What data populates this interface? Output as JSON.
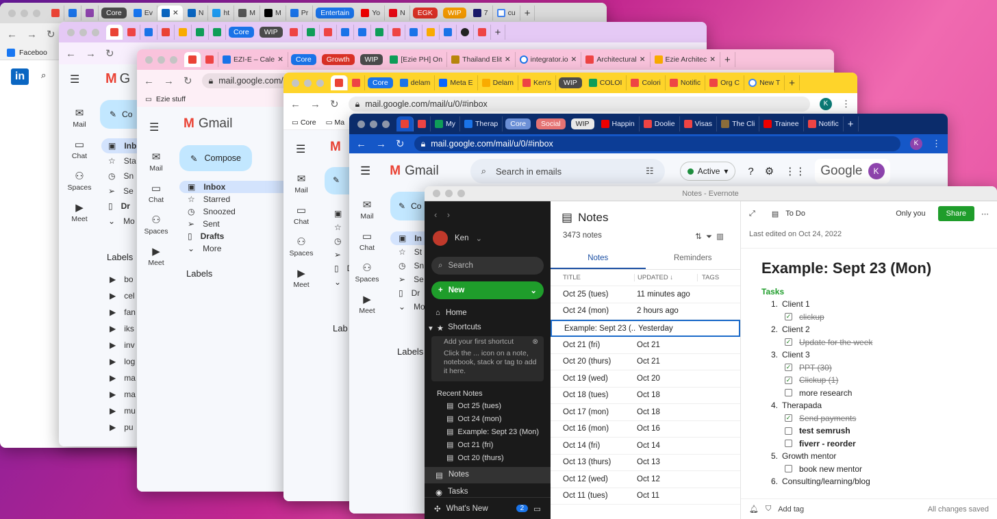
{
  "window1": {
    "tabs": [
      "Ev",
      "ht",
      "M",
      "Pr",
      "Yo",
      "N",
      "7",
      "cu"
    ],
    "groups": [
      {
        "label": "Core",
        "color": "#4a4a4a"
      },
      {
        "label": "Entertain",
        "color": "#1a73e8"
      },
      {
        "label": "EGK",
        "color": "#d93025"
      },
      {
        "label": "WIP",
        "color": "#f29900"
      }
    ],
    "bookmark": "Faceboo",
    "rail": [
      "Mail",
      "Chat",
      "Spaces",
      "Meet"
    ]
  },
  "window2": {
    "groups": [
      {
        "label": "Core",
        "color": "#1a73e8"
      },
      {
        "label": "WIP",
        "color": "#4a4a4a"
      }
    ],
    "gmail_g": "G",
    "compose": "Co",
    "rail": [
      "Mail",
      "Chat",
      "Spaces",
      "Meet"
    ],
    "nav": [
      "Inb",
      "Sta",
      "Sn",
      "Se",
      "Dr",
      "Mo"
    ],
    "labels_title": "Labels",
    "labels": [
      "bo",
      "cel",
      "fan",
      "iks",
      "inv",
      "log",
      "ma",
      "ma",
      "mu",
      "pu"
    ]
  },
  "window3": {
    "tabs": [
      "EZI-E – Cale",
      "[Ezie PH] On",
      "Thailand Elit",
      "integrator.io",
      "Architectural",
      "Ezie Architec"
    ],
    "groups": [
      {
        "label": "Core",
        "color": "#1a73e8"
      },
      {
        "label": "Growth",
        "color": "#d93025"
      },
      {
        "label": "WIP",
        "color": "#4a4a4a"
      }
    ],
    "url": "mail.google.com/mai",
    "bookmark": "Ezie stuff",
    "gmail_title": "Gmail",
    "compose": "Compose",
    "rail": [
      "Mail",
      "Chat",
      "Spaces",
      "Meet"
    ],
    "nav": [
      "Inbox",
      "Starred",
      "Snoozed",
      "Sent",
      "Drafts",
      "More"
    ],
    "labels_title": "Labels"
  },
  "window4": {
    "tabs": [
      "delam",
      "Meta E",
      "Delam",
      "Ken's",
      "COLOI",
      "Colori",
      "Notific",
      "Org C",
      "New T"
    ],
    "groups": [
      {
        "label": "Core",
        "color": "#1a73e8"
      },
      {
        "label": "WIP",
        "color": "#4a4a4a"
      }
    ],
    "url": "mail.google.com/mail/u/0/#inbox",
    "bookmarks": [
      "Core",
      "Ma"
    ],
    "rail": [
      "Mail",
      "Chat",
      "Spaces",
      "Meet"
    ],
    "nav": [
      "In",
      "St",
      "Sn",
      "Se",
      "Dr",
      "Mo"
    ],
    "labels_title": "Lab"
  },
  "window5": {
    "tabs": [
      "My",
      "Therap",
      "Happin",
      "Doolie",
      "Visas",
      "The Cli",
      "Trainee",
      "Notific"
    ],
    "groups": [
      {
        "label": "Core",
        "color": "#6b8fd6"
      },
      {
        "label": "Social",
        "color": "#e57373"
      },
      {
        "label": "WIP",
        "color": "#e8e8e8"
      }
    ],
    "url": "mail.google.com/mail/u/0/#inbox",
    "gmail_title": "Gmail",
    "search_placeholder": "Search in emails",
    "status": "Active",
    "google": "Google",
    "avatar": "K",
    "compose": "Co",
    "rail": [
      "Mail",
      "Chat",
      "Spaces",
      "Meet"
    ],
    "nav": [
      "In",
      "St",
      "Sn",
      "Se",
      "Dr",
      "Mo"
    ],
    "labels_title": "Labels"
  },
  "evernote": {
    "window_title": "Notes - Evernote",
    "user": "Ken",
    "search": "Search",
    "new_button": "New",
    "home": "Home",
    "shortcuts": "Shortcuts",
    "shortcut_title": "Add your first shortcut",
    "shortcut_hint": "Click the ... icon on a note, notebook, stack or tag to add it here.",
    "recent_title": "Recent Notes",
    "recent": [
      "Oct 25 (tues)",
      "Oct 24 (mon)",
      "Example: Sept 23 (Mon)",
      "Oct 21 (fri)",
      "Oct 20 (thurs)"
    ],
    "notes_nav": "Notes",
    "tasks_nav": "Tasks",
    "whats_new": "What's New",
    "whats_new_badge": "2",
    "list_title": "Notes",
    "note_count": "3473 notes",
    "tab_notes": "Notes",
    "tab_reminders": "Reminders",
    "col_title": "TITLE",
    "col_updated": "UPDATED",
    "col_tags": "TAGS",
    "rows": [
      {
        "title": "Oct 25 (tues)",
        "updated": "11 minutes ago"
      },
      {
        "title": "Oct 24 (mon)",
        "updated": "2 hours ago"
      },
      {
        "title": "Example: Sept 23 (...",
        "updated": "Yesterday"
      },
      {
        "title": "Oct 21 (fri)",
        "updated": "Oct 21"
      },
      {
        "title": "Oct 20 (thurs)",
        "updated": "Oct 21"
      },
      {
        "title": "Oct 19 (wed)",
        "updated": "Oct 20"
      },
      {
        "title": "Oct 18 (tues)",
        "updated": "Oct 18"
      },
      {
        "title": "Oct 17 (mon)",
        "updated": "Oct 18"
      },
      {
        "title": "Oct 16 (mon)",
        "updated": "Oct 16"
      },
      {
        "title": "Oct 14 (fri)",
        "updated": "Oct 14"
      },
      {
        "title": "Oct 13 (thurs)",
        "updated": "Oct 13"
      },
      {
        "title": "Oct 12 (wed)",
        "updated": "Oct 12"
      },
      {
        "title": "Oct 11 (tues)",
        "updated": "Oct 11"
      }
    ],
    "note": {
      "notebook": "To Do",
      "visibility": "Only you",
      "share": "Share",
      "last_edited": "Last edited on Oct 24, 2022",
      "title": "Example: Sept 23 (Mon)",
      "section": "Tasks",
      "items": [
        {
          "num": "1.",
          "text": "Client 1",
          "sub": [
            {
              "text": "clickup",
              "done": true
            }
          ]
        },
        {
          "num": "2.",
          "text": "Client 2",
          "sub": [
            {
              "text": "Update for the week",
              "done": true
            }
          ]
        },
        {
          "num": "3.",
          "text": "Client 3",
          "sub": [
            {
              "text": "PPT (30)",
              "done": true
            },
            {
              "text": "Clickup (1)",
              "done": true
            },
            {
              "text": "more research",
              "done": false
            }
          ]
        },
        {
          "num": "4.",
          "text": "Therapada",
          "sub": [
            {
              "text": "Send payments",
              "done": true
            },
            {
              "text": "test semrush",
              "done": false,
              "bold": true
            },
            {
              "text": "fiverr - reorder",
              "done": false,
              "bold": true
            }
          ]
        },
        {
          "num": "5.",
          "text": "Growth mentor",
          "sub": [
            {
              "text": "book new mentor",
              "done": false
            }
          ]
        },
        {
          "num": "6.",
          "text": "Consulting/learning/blog",
          "sub": []
        }
      ],
      "add_tag": "Add tag",
      "saved": "All changes saved"
    }
  }
}
